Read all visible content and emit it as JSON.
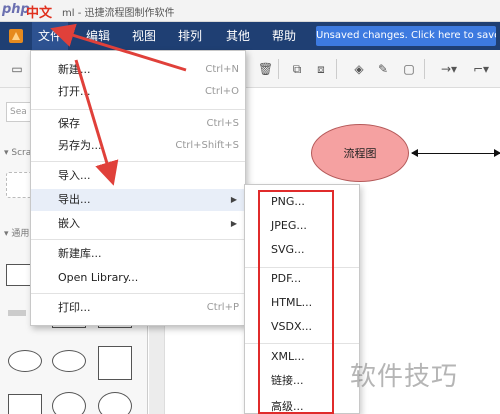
{
  "titlebar": {
    "logo_php": "php",
    "logo_cn": "中文网",
    "title": "ml - 迅捷流程图制作软件"
  },
  "menubar": {
    "items": [
      {
        "label": "文件",
        "active": true
      },
      {
        "label": "编辑"
      },
      {
        "label": "视图"
      },
      {
        "label": "排列"
      },
      {
        "label": "其他"
      },
      {
        "label": "帮助"
      }
    ],
    "unsaved_button": "Unsaved changes. Click here to save."
  },
  "sidebar": {
    "search_placeholder": "Sea",
    "section_scratchpad": "Scra",
    "section_general": "通用"
  },
  "file_menu": {
    "items": [
      {
        "label": "新建...",
        "shortcut": "Ctrl+N"
      },
      {
        "label": "打开...",
        "shortcut": "Ctrl+O"
      },
      {
        "label": "保存",
        "shortcut": "Ctrl+S"
      },
      {
        "label": "另存为...",
        "shortcut": "Ctrl+Shift+S"
      },
      {
        "label": "导入..."
      },
      {
        "label": "导出...",
        "submenu": true
      },
      {
        "label": "嵌入",
        "submenu": true
      },
      {
        "label": "新建库..."
      },
      {
        "label": "Open Library..."
      },
      {
        "label": "打印...",
        "shortcut": "Ctrl+P"
      }
    ]
  },
  "export_submenu": {
    "items": [
      "PNG...",
      "JPEG...",
      "SVG...",
      "PDF...",
      "HTML...",
      "VSDX...",
      "XML...",
      "链接...",
      "高级..."
    ]
  },
  "canvas": {
    "node_label": "流程图"
  },
  "watermark": "软件技巧",
  "colors": {
    "menubar": "#1f3f73",
    "unsaved_button": "#3d7ae0",
    "node_fill": "#f5a1a1",
    "highlight_box": "#e02b2b",
    "annotation_arrow": "#e0403a"
  }
}
